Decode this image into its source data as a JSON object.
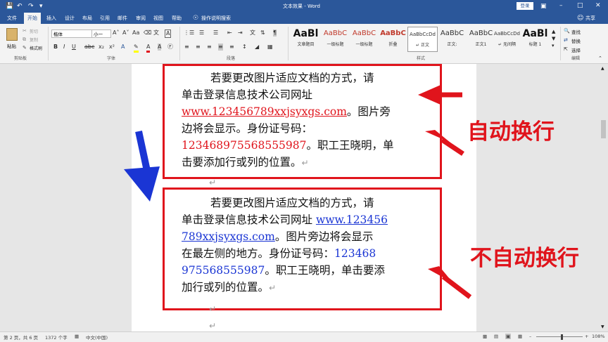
{
  "titlebar": {
    "title": "文本效果 - Word",
    "login_label": "登录",
    "icons": [
      "save-icon",
      "undo-icon",
      "redo-icon",
      "customize-icon",
      "ribbon-display-icon",
      "minimize-icon",
      "restore-icon",
      "close-icon"
    ]
  },
  "tabs": [
    {
      "label": "文件"
    },
    {
      "label": "开始",
      "active": true
    },
    {
      "label": "插入"
    },
    {
      "label": "设计"
    },
    {
      "label": "布局"
    },
    {
      "label": "引用"
    },
    {
      "label": "邮件"
    },
    {
      "label": "审阅"
    },
    {
      "label": "视图"
    },
    {
      "label": "帮助"
    }
  ],
  "tellme": {
    "label": "操作说明搜索"
  },
  "share": {
    "label": "共享"
  },
  "clipboard": {
    "paste": "粘贴",
    "cut": "剪切",
    "copy": "复制",
    "format_painter": "格式刷",
    "group": "剪贴板"
  },
  "font": {
    "name": "楷体",
    "size": "小一",
    "group": "字体"
  },
  "paragraph": {
    "group": "段落"
  },
  "styles": {
    "group": "样式",
    "items": [
      {
        "preview": "AaBl",
        "name": "文章题目",
        "color": "#111"
      },
      {
        "preview": "AaBbC",
        "name": "一级标题",
        "color": "#c0392b"
      },
      {
        "preview": "AaBbC",
        "name": "一级标题",
        "color": "#c0392b"
      },
      {
        "preview": "AaBbC",
        "name": "折叠",
        "color": "#c0392b"
      },
      {
        "preview": "AaBbCcDd",
        "name": "↵ 正文",
        "color": "#333",
        "selected": true
      },
      {
        "preview": "AaBbC",
        "name": "正文:",
        "color": "#333"
      },
      {
        "preview": "AaBbC",
        "name": "正文1",
        "color": "#333"
      },
      {
        "preview": "AaBbCcDd",
        "name": "↵ 无间隔",
        "color": "#333"
      },
      {
        "preview": "AaBl",
        "name": "标题 1",
        "color": "#111"
      }
    ]
  },
  "editing": {
    "find": "查找",
    "replace": "替换",
    "select": "选择",
    "group": "编辑"
  },
  "document": {
    "para1": {
      "line1": "若要更改图片适应文档的方式，请",
      "line2": "单击登录信息技术公司网址",
      "line3_link": "www.123456789xxjsyxgs.com",
      "line3_text": "。图片旁",
      "line4": "边将会显示。身份证号码：",
      "line5_id": "123468975568555987",
      "line5_text": "。职工王晓明，单",
      "line6": "击要添加行或列的位置。"
    },
    "para2": {
      "line1": "若要更改图片适应文档的方式，请",
      "line2_text": "单击登录信息技术公司网址 ",
      "line2_link": "www.123456",
      "line3_link": "789xxjsyxgs.com",
      "line3_text": "。图片旁边将会显示",
      "line4_text": "在最左侧的地方。身份证号码：",
      "line4_id": "123468",
      "line5_id": "975568555987",
      "line5_text": "。职工王晓明，单击要添",
      "line6": "加行或列的位置。"
    },
    "para_mark": "↵",
    "annotations": {
      "auto_wrap": "自动换行",
      "no_auto_wrap": "不自动换行"
    },
    "colors": {
      "box": "#e0141c",
      "blue_arrow": "#1a35d4",
      "red_arrow": "#e0141c"
    }
  },
  "statusbar": {
    "page": "第 2 页，共 6 页",
    "words": "1372 个字",
    "language": "中文(中国)",
    "zoom": "108%"
  }
}
